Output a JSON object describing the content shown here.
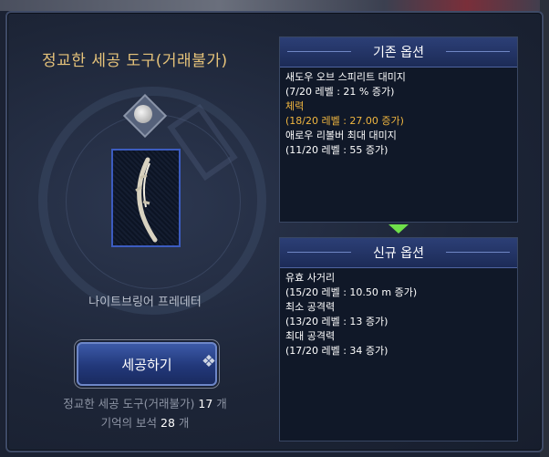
{
  "window": {
    "title": "정교한 세공 도구(거래불가)"
  },
  "item": {
    "name": "나이트브링어 프레데터"
  },
  "actions": {
    "craft_label": "세공하기"
  },
  "cost": {
    "line1_label": "정교한 세공 도구(거래불가)",
    "line1_count": "17",
    "line1_unit": "개",
    "line2_label": "기억의 보석",
    "line2_count": "28",
    "line2_unit": "개"
  },
  "existing": {
    "title": "기존 옵션",
    "lines": [
      "새도우 오브 스피리트 대미지",
      "(7/20 레벨 : 21 % 증가)",
      "체력",
      "(18/20 레벨 : 27.00 증가)",
      "애로우 리볼버 최대 대미지",
      "(11/20 레벨 : 55 증가)"
    ],
    "highlight_color": "#f0b640"
  },
  "new": {
    "title": "신규 옵션",
    "lines": [
      "유효 사거리",
      "(15/20 레벨 : 10.50 m 증가)",
      "최소 공격력",
      "(13/20 레벨 : 13 증가)",
      "최대 공격력",
      "(17/20 레벨 : 34 증가)"
    ]
  },
  "colors": {
    "title_gold": "#e6c37a",
    "arrow_green": "#6fe04a"
  }
}
